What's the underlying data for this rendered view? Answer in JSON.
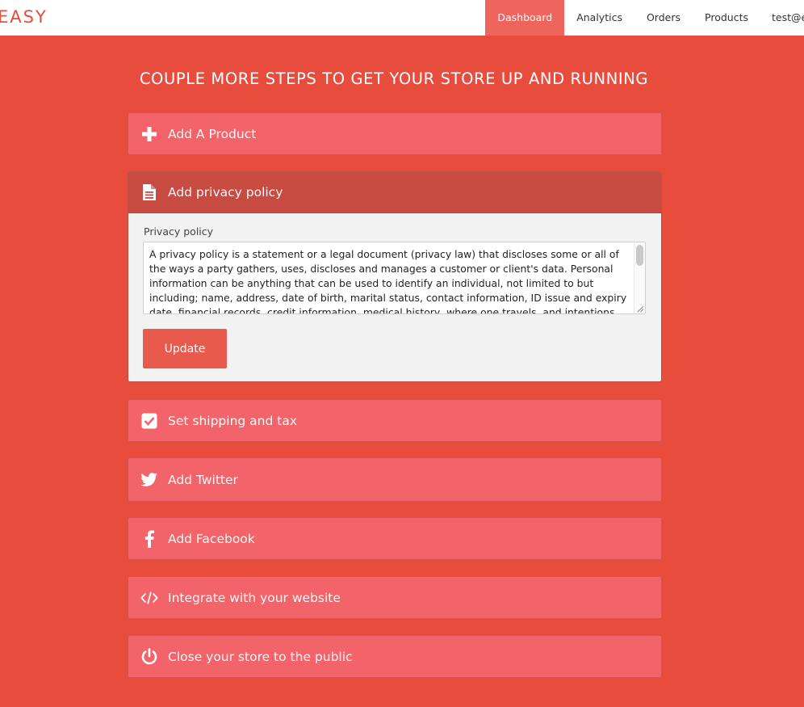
{
  "brand": {
    "logo": "EASY",
    "accent": "#e84c3d"
  },
  "nav": {
    "items": [
      {
        "label": "Dashboard",
        "active": true
      },
      {
        "label": "Analytics"
      },
      {
        "label": "Orders"
      },
      {
        "label": "Products"
      },
      {
        "label": "test@e"
      }
    ]
  },
  "heading": "COUPLE MORE STEPS TO GET YOUR STORE UP AND RUNNING",
  "steps": [
    {
      "label": "Add A Product",
      "icon": "plus-icon"
    },
    {
      "label": "Add privacy policy",
      "icon": "document-icon",
      "expanded": true,
      "field_label": "Privacy policy",
      "field_value": "A privacy policy is a statement or a legal document (privacy law) that discloses some or all of the ways a party gathers, uses, discloses and manages a customer or client's data. Personal information can be anything that can be used to identify an individual, not limited to but including; name, address, date of birth, marital status, contact information, ID issue and expiry date, financial records, credit information, medical history, where one travels, and intentions to acquire goods and services.",
      "button_label": "Update"
    },
    {
      "label": "Set shipping and tax",
      "icon": "checkbox-icon"
    },
    {
      "label": "Add Twitter",
      "icon": "twitter-icon"
    },
    {
      "label": "Add Facebook",
      "icon": "facebook-icon"
    },
    {
      "label": "Integrate with your website",
      "icon": "code-icon"
    },
    {
      "label": "Close your store to the public",
      "icon": "power-icon"
    }
  ]
}
